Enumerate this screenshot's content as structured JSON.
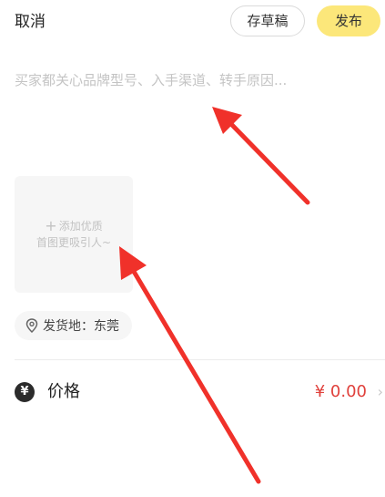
{
  "header": {
    "cancel_label": "取消",
    "draft_label": "存草稿",
    "publish_label": "发布"
  },
  "description": {
    "placeholder": "买家都关心品牌型号、入手渠道、转手原因...",
    "value": ""
  },
  "photo": {
    "line1": "添加优质",
    "line2": "首图更吸引人~",
    "icon": "plus-icon"
  },
  "location": {
    "icon": "location-pin-icon",
    "label": "发货地：东莞"
  },
  "price": {
    "icon": "yen-icon",
    "icon_glyph": "¥",
    "label": "价格",
    "value": "¥ 0.00",
    "chevron": "›"
  },
  "colors": {
    "publish_bg": "#fce77a",
    "price_red": "#e0413c",
    "annotation_arrow": "#f0312a"
  }
}
